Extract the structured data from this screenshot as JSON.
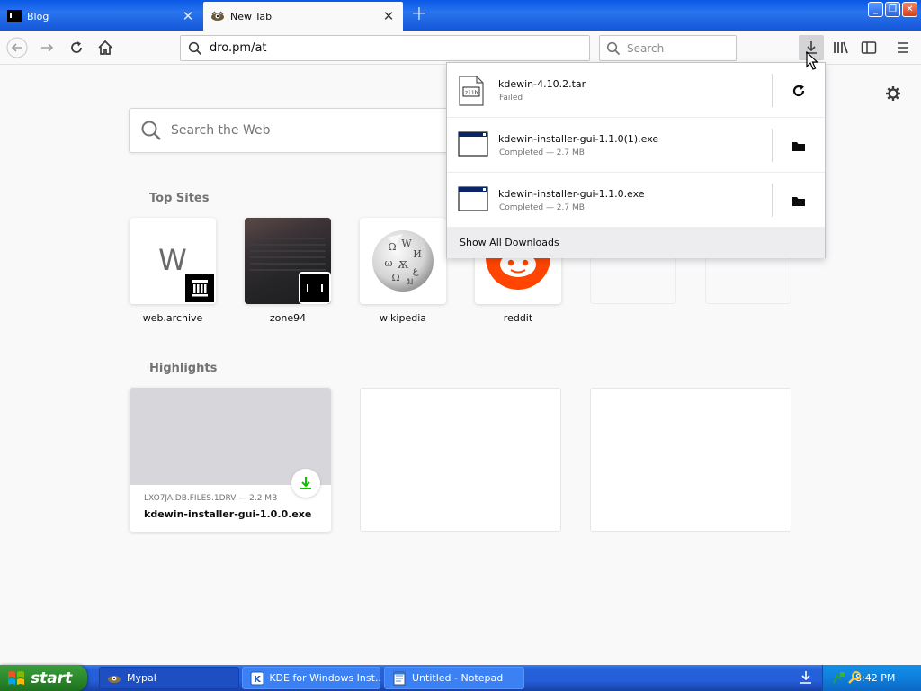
{
  "tabs": [
    {
      "title": "Blog",
      "active": false
    },
    {
      "title": "New Tab",
      "active": true
    }
  ],
  "toolbar": {
    "url": "dro.pm/at",
    "search_placeholder": "Search"
  },
  "newtab": {
    "search_placeholder": "Search the Web",
    "top_sites_title": "Top Sites",
    "top_sites": [
      {
        "label": "web.archive",
        "letter": "W"
      },
      {
        "label": "zone94"
      },
      {
        "label": "wikipedia"
      },
      {
        "label": "reddit"
      }
    ],
    "highlights_title": "Highlights",
    "highlight": {
      "meta": "LXO7JA.DB.FILES.1DRV — 2.2 MB",
      "name": "kdewin-installer-gui-1.0.0.exe"
    }
  },
  "downloads": {
    "items": [
      {
        "name": "kdewin-4.10.2.tar",
        "status": "Failed",
        "action_icon": "retry-icon"
      },
      {
        "name": "kdewin-installer-gui-1.1.0(1).exe",
        "status": "Completed — 2.7 MB",
        "action_icon": "folder-icon"
      },
      {
        "name": "kdewin-installer-gui-1.1.0.exe",
        "status": "Completed — 2.7 MB",
        "action_icon": "folder-icon"
      }
    ],
    "show_all": "Show All Downloads"
  },
  "taskbar": {
    "start": "start",
    "tasks": [
      {
        "label": "Mypal"
      },
      {
        "label": "KDE for Windows Inst..."
      },
      {
        "label": "Untitled - Notepad"
      }
    ],
    "clock": "8:42 PM"
  },
  "colors": {
    "titlebar_blue": "#0a58e6",
    "accent_blue": "#0a84ff",
    "reddit_orange": "#ff4500",
    "download_green": "#12bc00"
  }
}
